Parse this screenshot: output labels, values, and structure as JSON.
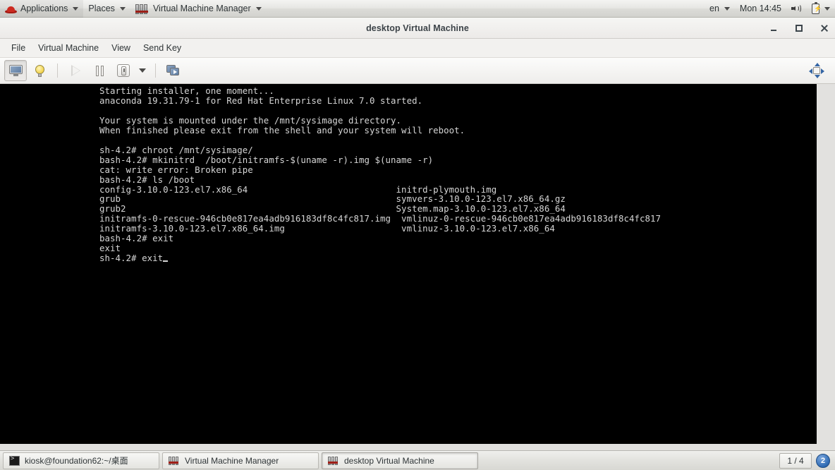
{
  "top_panel": {
    "activities_icon": "redhat-icon",
    "menus": [
      {
        "label": "Applications",
        "icon": "redhat-icon",
        "has_caret": true
      },
      {
        "label": "Places",
        "icon": null,
        "has_caret": true
      },
      {
        "label": "Virtual Machine Manager",
        "icon": "vmm-icon",
        "has_caret": true
      }
    ],
    "status": {
      "keyboard_layout": "en",
      "clock": "Mon 14:45",
      "volume_icon": "volume-icon",
      "battery_icon": "battery-icon",
      "system_menu_caret": "chevron-down-icon"
    }
  },
  "window": {
    "title": "desktop Virtual Machine",
    "controls": {
      "minimize": "minimize-icon",
      "maximize": "maximize-icon",
      "close": "close-icon"
    },
    "menubar": [
      "File",
      "Virtual Machine",
      "View",
      "Send Key"
    ],
    "toolbar": {
      "buttons": [
        {
          "name": "console-view-button",
          "icon": "monitor-icon",
          "state": "active"
        },
        {
          "name": "details-view-button",
          "icon": "lightbulb-icon",
          "state": "normal"
        },
        {
          "name": "run-button",
          "icon": "play-icon",
          "state": "disabled"
        },
        {
          "name": "pause-button",
          "icon": "pause-icon",
          "state": "normal"
        },
        {
          "name": "shutdown-button",
          "icon": "power-icon",
          "state": "normal"
        },
        {
          "name": "shutdown-menu-caret",
          "icon": "chevron-down-icon",
          "state": "normal"
        },
        {
          "name": "snapshots-button",
          "icon": "clone-screens-icon",
          "state": "normal"
        }
      ],
      "right_button": {
        "name": "fullscreen-resize-button",
        "icon": "resize-arrows-icon"
      }
    }
  },
  "console": {
    "background_color": "#000000",
    "text_color": "#d6d6d6",
    "lines": [
      "Starting installer, one moment...",
      "anaconda 19.31.79-1 for Red Hat Enterprise Linux 7.0 started.",
      "",
      "Your system is mounted under the /mnt/sysimage directory.",
      "When finished please exit from the shell and your system will reboot.",
      "",
      "sh-4.2# chroot /mnt/sysimage/",
      "bash-4.2# mkinitrd  /boot/initramfs-$(uname -r).img $(uname -r)",
      "cat: write error: Broken pipe",
      "bash-4.2# ls /boot",
      "config-3.10.0-123.el7.x86_64                            initrd-plymouth.img",
      "grub                                                    symvers-3.10.0-123.el7.x86_64.gz",
      "grub2                                                   System.map-3.10.0-123.el7.x86_64",
      "initramfs-0-rescue-946cb0e817ea4adb916183df8c4fc817.img  vmlinuz-0-rescue-946cb0e817ea4adb916183df8c4fc817",
      "initramfs-3.10.0-123.el7.x86_64.img                      vmlinuz-3.10.0-123.el7.x86_64",
      "bash-4.2# exit",
      "exit"
    ],
    "prompt_line": "sh-4.2# exit"
  },
  "taskbar": {
    "items": [
      {
        "label": "kiosk@foundation62:~/桌面",
        "icon": "terminal-icon",
        "active": false
      },
      {
        "label": "Virtual Machine Manager",
        "icon": "vmm-icon",
        "active": false
      },
      {
        "label": "desktop Virtual Machine",
        "icon": "vmm-icon",
        "active": true
      }
    ],
    "workspace_indicator": "1 / 4",
    "notification_count": "2"
  },
  "colors": {
    "panel_bg": "#e6e6e3",
    "console_bg": "#000000",
    "console_fg": "#d6d6d6",
    "accent_blue": "#3465a4",
    "redhat_red": "#cc2a20"
  }
}
